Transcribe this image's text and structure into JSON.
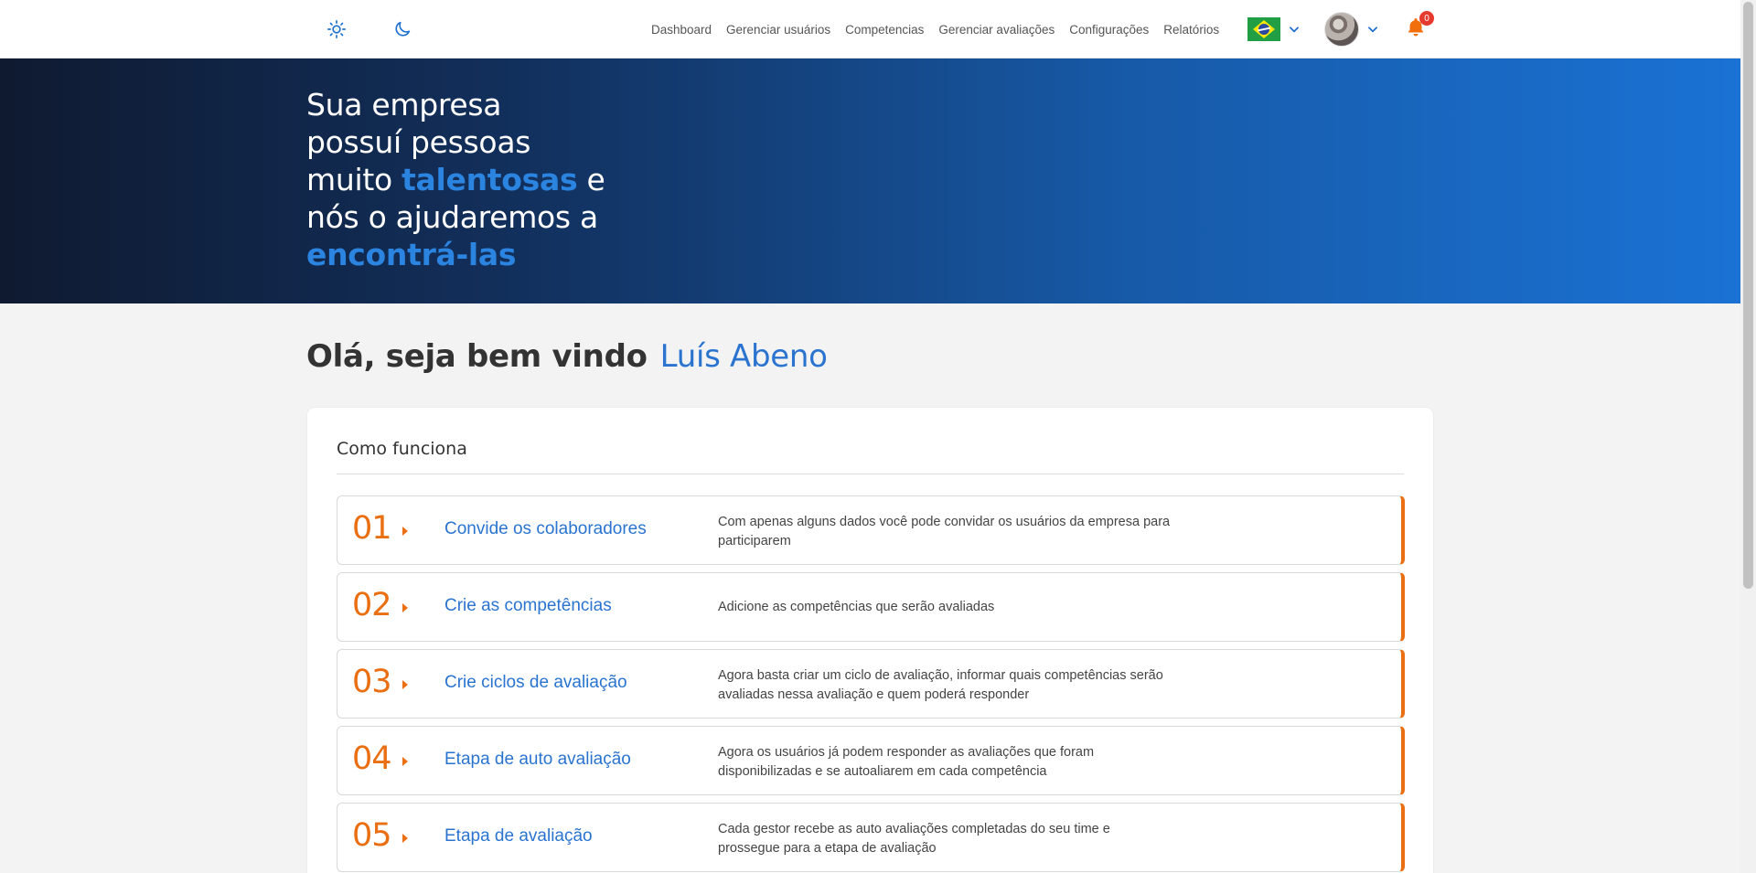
{
  "header": {
    "theme_light_icon": "sun-icon",
    "theme_dark_icon": "moon-icon",
    "nav": [
      {
        "label": "Dashboard"
      },
      {
        "label": "Gerenciar usuários"
      },
      {
        "label": "Competencias"
      },
      {
        "label": "Gerenciar avaliações"
      },
      {
        "label": "Configurações"
      },
      {
        "label": "Relatórios"
      }
    ],
    "language_flag": "brazil-flag",
    "notifications_count": "0",
    "accent_color": "#1f6fd0"
  },
  "hero": {
    "line1": "Sua empresa",
    "line2": "possuí pessoas",
    "line3_a": "muito ",
    "line3_hl": "talentosas",
    "line3_b": " e",
    "line4": "nós o ajudaremos a",
    "line5_hl": "encontrá-las"
  },
  "greeting": {
    "text": "Olá, seja bem vindo",
    "name": "Luís Abeno"
  },
  "how_it_works": {
    "title": "Como funciona",
    "accent_color": "#ea6f12",
    "steps": [
      {
        "number": "01",
        "title": "Convide os colaboradores",
        "description": "Com apenas alguns dados você pode convidar os usuários da empresa para participarem"
      },
      {
        "number": "02",
        "title": "Crie as competências",
        "description": "Adicione as competências que serão avaliadas"
      },
      {
        "number": "03",
        "title": "Crie ciclos de avaliação",
        "description": "Agora basta criar um ciclo de avaliação, informar quais competências serão avaliadas nessa avaliação e quem poderá responder"
      },
      {
        "number": "04",
        "title": "Etapa de auto avaliação",
        "description": "Agora os usuários já podem responder as avaliações que foram disponibilizadas e se autoaliarem em cada competência"
      },
      {
        "number": "05",
        "title": "Etapa de avaliação",
        "description": "Cada gestor recebe as auto avaliações completadas do seu time e prossegue para a etapa de avaliação"
      }
    ]
  }
}
